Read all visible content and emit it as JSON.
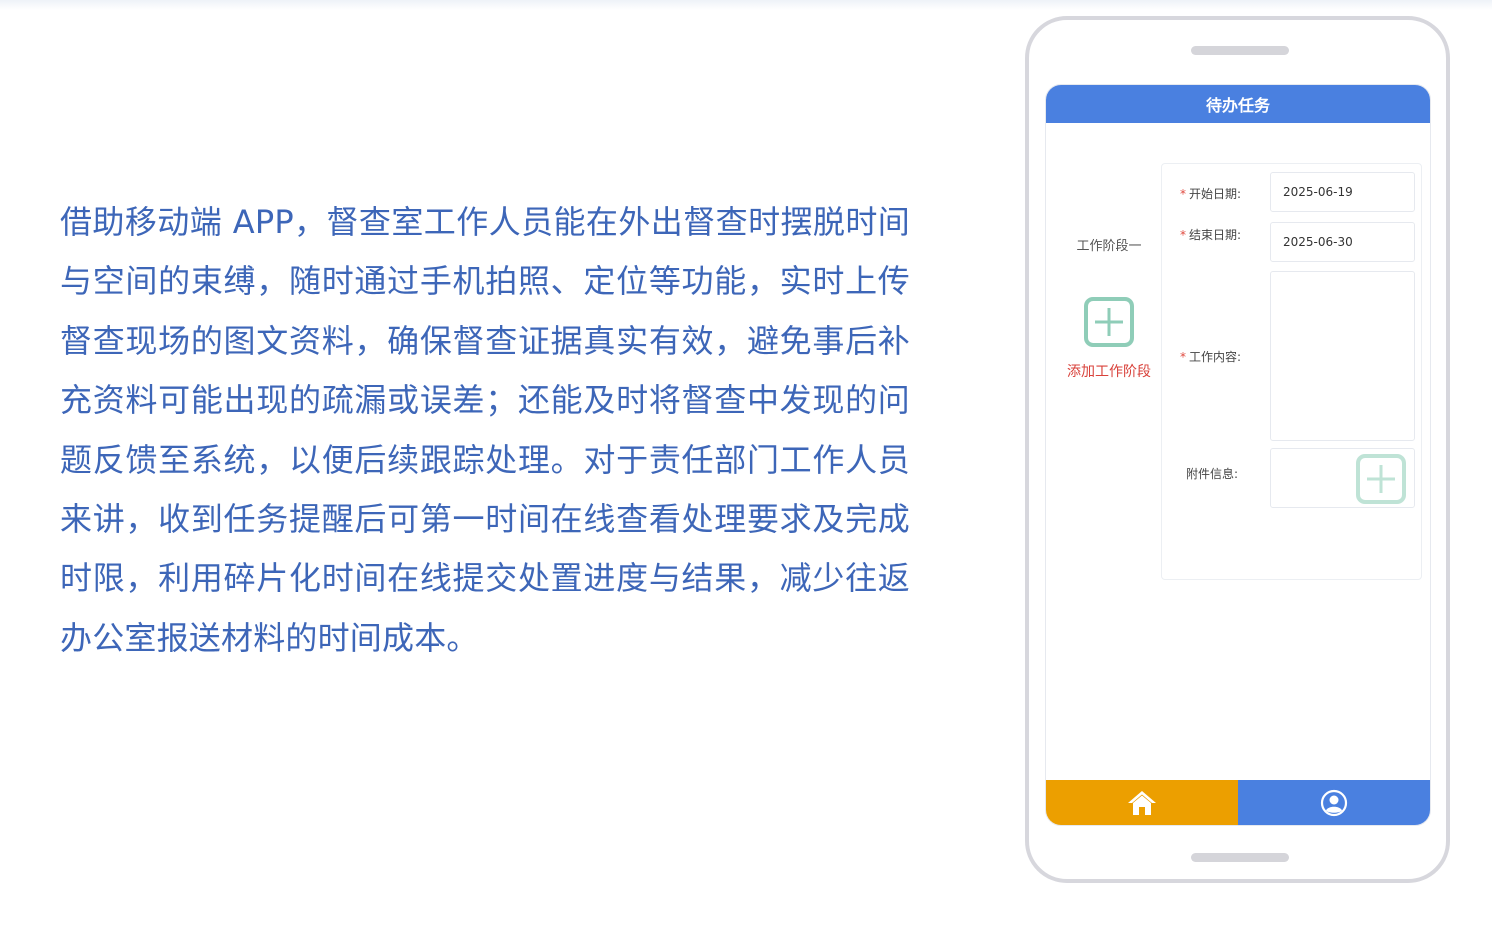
{
  "description": {
    "paragraph": "借助移动端 APP，督查室工作人员能在外出督查时摆脱时间与空间的束缚，随时通过手机拍照、定位等功能，实时上传督查现场的图文资料，确保督查证据真实有效，避免事后补充资料可能出现的疏漏或误差；还能及时将督查中发现的问题反馈至系统，以便后续跟踪处理。对于责任部门工作人员来讲，收到任务提醒后可第一时间在线查看处理要求及完成时限，利用碎片化时间在线提交处置进度与结果，减少往返办公室报送材料的时间成本。"
  },
  "app": {
    "header": {
      "title": "待办任务"
    },
    "stage": {
      "name": "工作阶段一",
      "add_label": "添加工作阶段",
      "add_icon": "plus-square-icon"
    },
    "form": {
      "required_mark": "*",
      "start_date": {
        "label": "开始日期:",
        "value": "2025-06-19"
      },
      "end_date": {
        "label": "结束日期:",
        "value": "2025-06-30"
      },
      "work_content": {
        "label": "工作内容:",
        "value": ""
      },
      "attachment": {
        "label": "附件信息:",
        "icon": "plus-square-icon"
      }
    },
    "tabbar": {
      "home_icon": "home-icon",
      "profile_icon": "user-circle-icon"
    }
  },
  "colors": {
    "paragraph_text": "#3d66b8",
    "header_bg": "#4a80e0",
    "home_tab_bg": "#ec9f00",
    "profile_tab_bg": "#4a80e0",
    "add_stage_text": "#d9423b",
    "icon_green": "#8fcdb8"
  }
}
